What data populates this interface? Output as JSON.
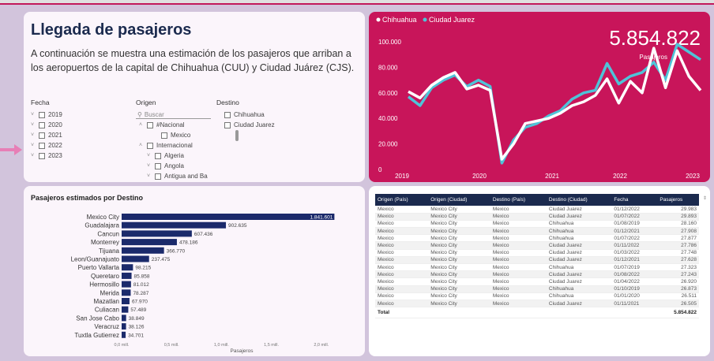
{
  "intro": {
    "title": "Llegada de pasajeros",
    "description": "A continuación se muestra una estimación de los pasajeros que arriban a los aeropuertos de la capital de Chihuahua (CUU) y Ciudad Juárez (CJS)."
  },
  "slicers": {
    "fecha": {
      "title": "Fecha",
      "items": [
        "2019",
        "2020",
        "2021",
        "2022",
        "2023"
      ]
    },
    "origen": {
      "title": "Origen",
      "search_placeholder": "Buscar",
      "items": [
        "#Nacional",
        "Mexico",
        "Internacional",
        "Algeria",
        "Angola",
        "Antigua and Ba"
      ]
    },
    "destino": {
      "title": "Destino",
      "items": [
        "Chihuahua",
        "Ciudad Juarez"
      ]
    }
  },
  "line_chart": {
    "legend": [
      "Chihuahua",
      "Ciudad Juarez"
    ],
    "kpi_value": "5.854.822",
    "kpi_label": "Pasajeros",
    "colors": {
      "chihuahua": "#ffffff",
      "juarez": "#4fc3d8",
      "background": "#c8155a"
    },
    "chart_data": {
      "type": "line",
      "x": [
        "2019-01",
        "2019-03",
        "2019-05",
        "2019-07",
        "2019-09",
        "2019-11",
        "2020-01",
        "2020-03",
        "2020-05",
        "2020-07",
        "2020-09",
        "2020-11",
        "2021-01",
        "2021-03",
        "2021-05",
        "2021-07",
        "2021-09",
        "2021-11",
        "2022-01",
        "2022-03",
        "2022-05",
        "2022-07",
        "2022-09",
        "2022-11",
        "2023-01",
        "2023-03"
      ],
      "series": [
        {
          "name": "Chihuahua",
          "values": [
            61000,
            56000,
            66000,
            72000,
            76000,
            63000,
            66000,
            62000,
            8000,
            20000,
            36000,
            38000,
            40000,
            44000,
            50000,
            53000,
            58000,
            71000,
            52000,
            69000,
            60000,
            95000,
            64000,
            93000,
            73000,
            62000
          ]
        },
        {
          "name": "Ciudad Juarez",
          "values": [
            57000,
            50000,
            64000,
            70000,
            74000,
            65000,
            70000,
            65000,
            5000,
            23000,
            33000,
            36000,
            42000,
            46000,
            55000,
            60000,
            62000,
            83000,
            67000,
            73000,
            76000,
            84000,
            70000,
            98000,
            92000,
            86000
          ]
        }
      ],
      "x_ticks": [
        "2019",
        "2020",
        "2021",
        "2022",
        "2023"
      ],
      "y_ticks": [
        "0",
        "20.000",
        "40.000",
        "60.000",
        "80.000",
        "100.000"
      ],
      "ylim": [
        0,
        100000
      ]
    }
  },
  "bar_chart": {
    "title": "Pasajeros estimados por Destino",
    "xlabel": "Pasajeros",
    "x_ticks": [
      "0,0 mill.",
      "0,5 mill.",
      "1,0 mill.",
      "1,5 mill.",
      "2,0 mill."
    ],
    "color": "#1b2a6b",
    "chart_data": {
      "type": "bar",
      "categories": [
        "Mexico City",
        "Guadalajara",
        "Cancun",
        "Monterrey",
        "Tijuana",
        "Leon/Guanajuato",
        "Puerto Vallarta",
        "Queretaro",
        "Hermosillo",
        "Merida",
        "Mazatlan",
        "Culiacan",
        "San Jose Cabo",
        "Veracruz",
        "Tuxtla Gutierrez"
      ],
      "values": [
        1841601,
        902635,
        607436,
        478186,
        366770,
        237475,
        98215,
        85858,
        81012,
        78287,
        67970,
        57489,
        38849,
        38126,
        34701
      ],
      "labels": [
        "1.841.601",
        "902.635",
        "607.436",
        "478.186",
        "366.770",
        "237.475",
        "98.215",
        "85.858",
        "81.012",
        "78.287",
        "67.970",
        "57.489",
        "38.849",
        "38.126",
        "34.701"
      ],
      "xlim": [
        0,
        2000000
      ]
    }
  },
  "table": {
    "headers": [
      "Origen (País)",
      "Origen (Ciudad)",
      "Destino (País)",
      "Destino (Ciudad)",
      "Fecha",
      "Pasajeros"
    ],
    "rows": [
      [
        "Mexico",
        "Mexico City",
        "Mexico",
        "Ciudad Juarez",
        "01/12/2022",
        "29.983"
      ],
      [
        "Mexico",
        "Mexico City",
        "Mexico",
        "Ciudad Juarez",
        "01/07/2022",
        "29.893"
      ],
      [
        "Mexico",
        "Mexico City",
        "Mexico",
        "Chihuahua",
        "01/08/2019",
        "28.160"
      ],
      [
        "Mexico",
        "Mexico City",
        "Mexico",
        "Chihuahua",
        "01/12/2021",
        "27.908"
      ],
      [
        "Mexico",
        "Mexico City",
        "Mexico",
        "Chihuahua",
        "01/07/2022",
        "27.877"
      ],
      [
        "Mexico",
        "Mexico City",
        "Mexico",
        "Ciudad Juarez",
        "01/11/2022",
        "27.786"
      ],
      [
        "Mexico",
        "Mexico City",
        "Mexico",
        "Ciudad Juarez",
        "01/03/2022",
        "27.748"
      ],
      [
        "Mexico",
        "Mexico City",
        "Mexico",
        "Ciudad Juarez",
        "01/12/2021",
        "27.628"
      ],
      [
        "Mexico",
        "Mexico City",
        "Mexico",
        "Chihuahua",
        "01/07/2019",
        "27.323"
      ],
      [
        "Mexico",
        "Mexico City",
        "Mexico",
        "Ciudad Juarez",
        "01/08/2022",
        "27.243"
      ],
      [
        "Mexico",
        "Mexico City",
        "Mexico",
        "Ciudad Juarez",
        "01/04/2022",
        "26.920"
      ],
      [
        "Mexico",
        "Mexico City",
        "Mexico",
        "Chihuahua",
        "01/10/2019",
        "26.873"
      ],
      [
        "Mexico",
        "Mexico City",
        "Mexico",
        "Chihuahua",
        "01/01/2020",
        "26.511"
      ],
      [
        "Mexico",
        "Mexico City",
        "Mexico",
        "Ciudad Juarez",
        "01/11/2021",
        "26.505"
      ]
    ],
    "total_label": "Total",
    "total_value": "5.854.822"
  }
}
